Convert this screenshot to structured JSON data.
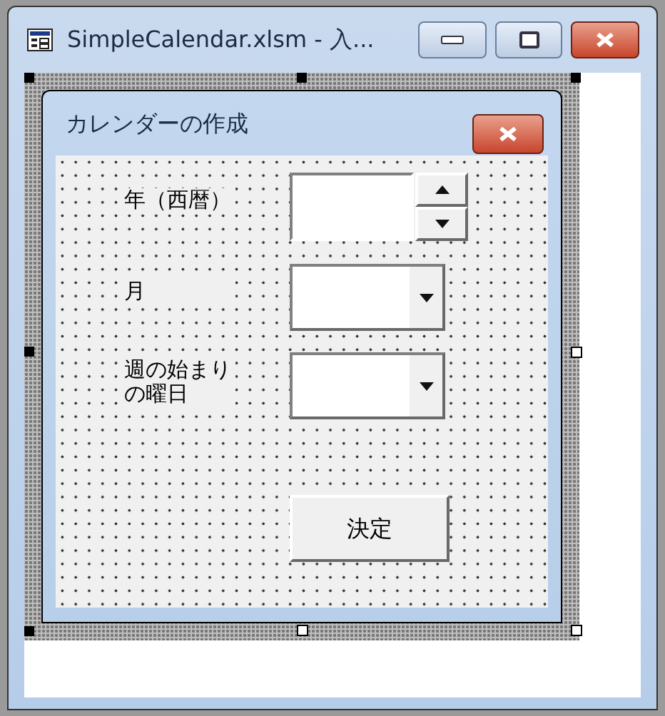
{
  "window": {
    "title": "SimpleCalendar.xlsm - 入..."
  },
  "form": {
    "title": "カレンダーの作成",
    "rows": [
      {
        "label": "年（西暦）",
        "kind": "spin"
      },
      {
        "label": "月",
        "kind": "combo"
      },
      {
        "label": "週の始まりの曜日",
        "kind": "combo"
      }
    ],
    "button": "決定"
  }
}
